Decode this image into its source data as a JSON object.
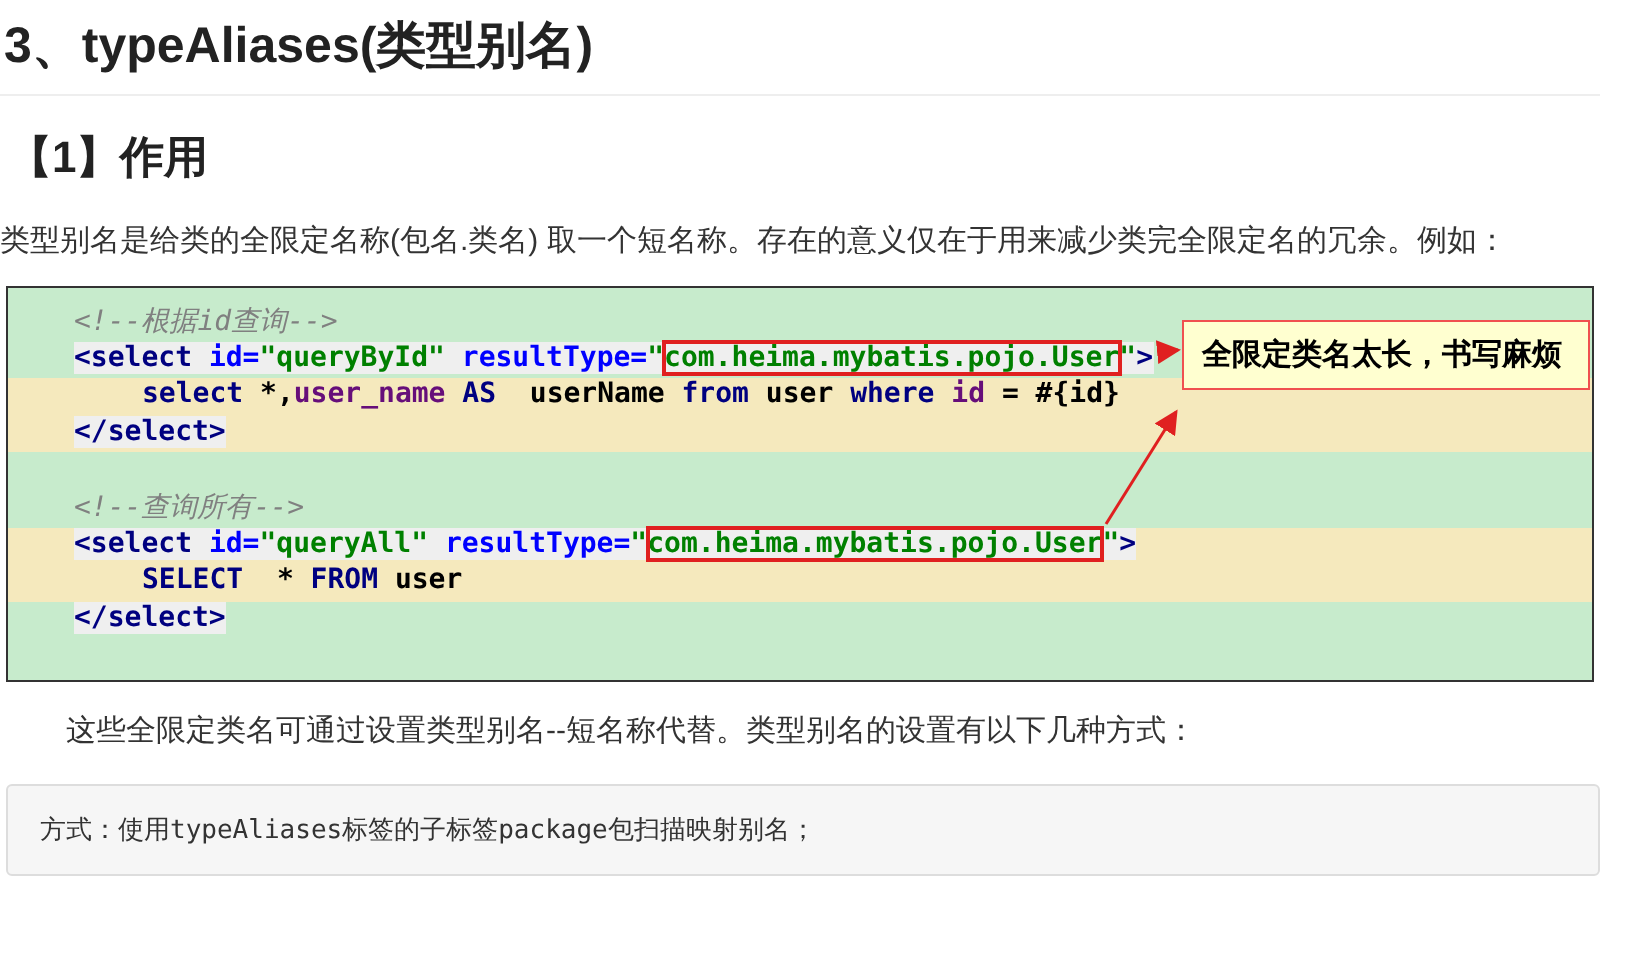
{
  "heading": "3、typeAliases(类型别名)",
  "subheading": "【1】作用",
  "intro": "类型别名是给类的全限定名称(包名.类名) 取一个短名称。存在的意义仅在于用来减少类完全限定名的冗余。例如：",
  "code_screenshot": {
    "lines": [
      {
        "kind": "comment",
        "highlighted": false,
        "indented": false,
        "segments": [
          {
            "kind": "comment",
            "text": "<!--根据id查询-->"
          }
        ]
      },
      {
        "kind": "tag",
        "highlighted": false,
        "indented": false,
        "segments": [
          {
            "kind": "tag",
            "text": "<select "
          },
          {
            "kind": "attr",
            "text": "id="
          },
          {
            "kind": "string",
            "text": "\"queryById\" "
          },
          {
            "kind": "attr",
            "text": "resultType="
          },
          {
            "kind": "string",
            "text": "\""
          },
          {
            "kind": "class",
            "text": "com.heima.mybatis.pojo.User"
          },
          {
            "kind": "string",
            "text": "\""
          },
          {
            "kind": "tag",
            "text": ">"
          }
        ]
      },
      {
        "kind": "sql",
        "highlighted": true,
        "indented": true,
        "segments": [
          {
            "kind": "keyword",
            "text": "select "
          },
          {
            "kind": "plain",
            "text": "*,"
          },
          {
            "kind": "column",
            "text": "user_name "
          },
          {
            "kind": "keyword",
            "text": "AS  "
          },
          {
            "kind": "plain",
            "text": "userName "
          },
          {
            "kind": "keyword",
            "text": "from "
          },
          {
            "kind": "plain",
            "text": "user "
          },
          {
            "kind": "keyword",
            "text": "where "
          },
          {
            "kind": "column",
            "text": "id "
          },
          {
            "kind": "plain",
            "text": "= #{id}"
          }
        ]
      },
      {
        "kind": "tag",
        "highlighted": true,
        "indented": false,
        "segments": [
          {
            "kind": "tag",
            "text": "</select>"
          }
        ]
      },
      {
        "kind": "blank",
        "highlighted": false
      },
      {
        "kind": "comment",
        "highlighted": false,
        "indented": false,
        "segments": [
          {
            "kind": "comment",
            "text": "<!--查询所有-->"
          }
        ]
      },
      {
        "kind": "tag",
        "highlighted": true,
        "indented": false,
        "segments": [
          {
            "kind": "tag",
            "text": "<select "
          },
          {
            "kind": "attr",
            "text": "id="
          },
          {
            "kind": "string",
            "text": "\"queryAll\" "
          },
          {
            "kind": "attr",
            "text": "resultType="
          },
          {
            "kind": "string",
            "text": "\""
          },
          {
            "kind": "class",
            "text": "com.heima.mybatis.pojo.User"
          },
          {
            "kind": "string",
            "text": "\""
          },
          {
            "kind": "tag",
            "text": ">"
          }
        ]
      },
      {
        "kind": "sql",
        "highlighted": true,
        "indented": true,
        "segments": [
          {
            "kind": "keyword",
            "text": "SELECT  "
          },
          {
            "kind": "plain",
            "text": "* "
          },
          {
            "kind": "keyword",
            "text": "FROM "
          },
          {
            "kind": "plain",
            "text": "user"
          }
        ]
      },
      {
        "kind": "tag",
        "highlighted": false,
        "indented": false,
        "segments": [
          {
            "kind": "tag",
            "text": "</select>"
          }
        ]
      }
    ],
    "callout": "全限定类名太长，书写麻烦"
  },
  "explanation": "这些全限定类名可通过设置类型别名--短名称代替。类型别名的设置有以下几种方式：",
  "note": "方式：使用typeAliases标签的子标签package包扫描映射别名；"
}
